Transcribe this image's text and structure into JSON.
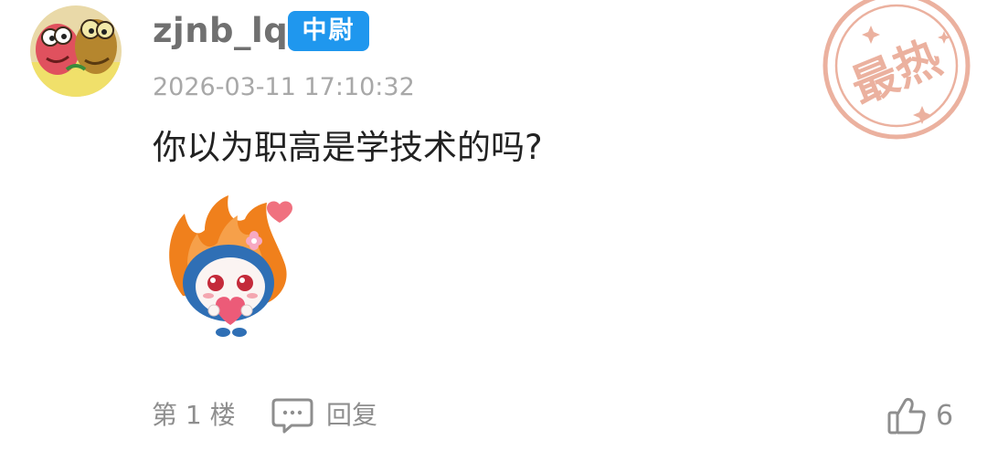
{
  "comment": {
    "username": "zjnb_lq",
    "rank_badge": "中尉",
    "timestamp": "2026-03-11 17:10:32",
    "hot_stamp_text": "最热",
    "text": "你以为职高是学技术的吗?",
    "sticker_icon": "flame-mascot-holding-heart-sticker",
    "floor_label": "第 1 楼",
    "reply_label": "回复",
    "like_count": "6"
  },
  "colors": {
    "badge_bg": "#1f97ee",
    "stamp": "#e8a48f",
    "muted_text": "#8e8e8e",
    "main_text": "#222222"
  }
}
